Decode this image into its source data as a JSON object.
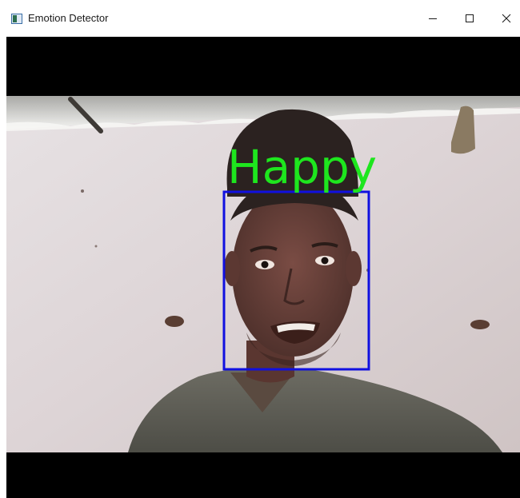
{
  "window": {
    "title": "Emotion Detector",
    "icon": "app-window-icon",
    "controls": {
      "minimize": "minimize-icon",
      "maximize": "maximize-icon",
      "close": "close-icon"
    }
  },
  "detection": {
    "emotion_label": "Happy",
    "label_color": "#1ee61e",
    "box_color": "#1010e0"
  }
}
